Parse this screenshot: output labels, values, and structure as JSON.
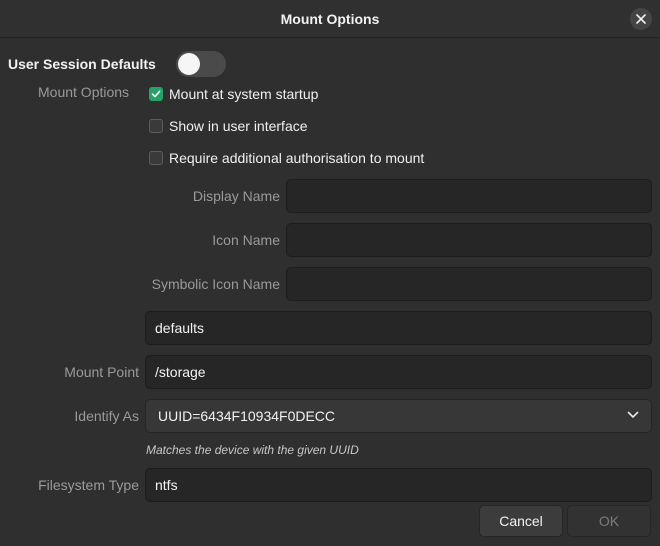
{
  "window": {
    "title": "Mount Options",
    "close_icon": "close-icon"
  },
  "session": {
    "label": "User Session Defaults",
    "toggle_on": false
  },
  "mount_options": {
    "label": "Mount Options",
    "checkboxes": [
      {
        "label": "Mount at system startup",
        "checked": true
      },
      {
        "label": "Show in user interface",
        "checked": false
      },
      {
        "label": "Require additional authorisation to mount",
        "checked": false
      }
    ],
    "display_name": {
      "label": "Display Name",
      "value": ""
    },
    "icon_name": {
      "label": "Icon Name",
      "value": ""
    },
    "symbolic_icon_name": {
      "label": "Symbolic Icon Name",
      "value": ""
    },
    "options_value": "defaults"
  },
  "mount_point": {
    "label": "Mount Point",
    "value": "/storage"
  },
  "identify_as": {
    "label": "Identify As",
    "value": "UUID=6434F10934F0DECC",
    "hint": "Matches the device with the given UUID"
  },
  "filesystem_type": {
    "label": "Filesystem Type",
    "value": "ntfs"
  },
  "buttons": {
    "cancel": "Cancel",
    "ok": "OK"
  },
  "colors": {
    "accent": "#26a269",
    "background": "#2f2f2f",
    "entry_background": "#262626"
  }
}
